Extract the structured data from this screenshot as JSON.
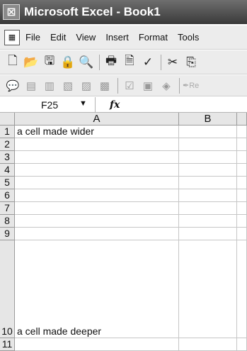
{
  "window": {
    "title": "Microsoft Excel - Book1",
    "app_icon": "excel-icon"
  },
  "menubar": {
    "items": [
      "File",
      "Edit",
      "View",
      "Insert",
      "Format",
      "Tools"
    ]
  },
  "toolbar_standard": {
    "icons": [
      "new-icon",
      "open-icon",
      "save-icon",
      "permission-icon",
      "research-icon",
      "print-icon",
      "print-preview-icon",
      "spelling-icon",
      "cut-icon",
      "copy-icon"
    ]
  },
  "toolbar_reviewing": {
    "icons": [
      "reviewing-icon-1",
      "reviewing-icon-2",
      "reviewing-icon-3",
      "reviewing-icon-4",
      "reviewing-icon-5",
      "reviewing-icon-6",
      "reviewing-icon-7",
      "reviewing-icon-8",
      "reviewing-icon-9"
    ],
    "reply_label": "Re"
  },
  "formula_bar": {
    "name_box": "F25",
    "fx_label": "fx",
    "formula": ""
  },
  "sheet": {
    "columns": [
      "A",
      "B"
    ],
    "rows": [
      {
        "num": "1",
        "a": "a cell made wider",
        "b": ""
      },
      {
        "num": "2",
        "a": "",
        "b": ""
      },
      {
        "num": "3",
        "a": "",
        "b": ""
      },
      {
        "num": "4",
        "a": "",
        "b": ""
      },
      {
        "num": "5",
        "a": "",
        "b": ""
      },
      {
        "num": "6",
        "a": "",
        "b": ""
      },
      {
        "num": "7",
        "a": "",
        "b": ""
      },
      {
        "num": "8",
        "a": "",
        "b": ""
      },
      {
        "num": "9",
        "a": "",
        "b": ""
      },
      {
        "num": "10",
        "a": "a cell made deeper",
        "b": ""
      },
      {
        "num": "11",
        "a": "",
        "b": ""
      }
    ]
  }
}
